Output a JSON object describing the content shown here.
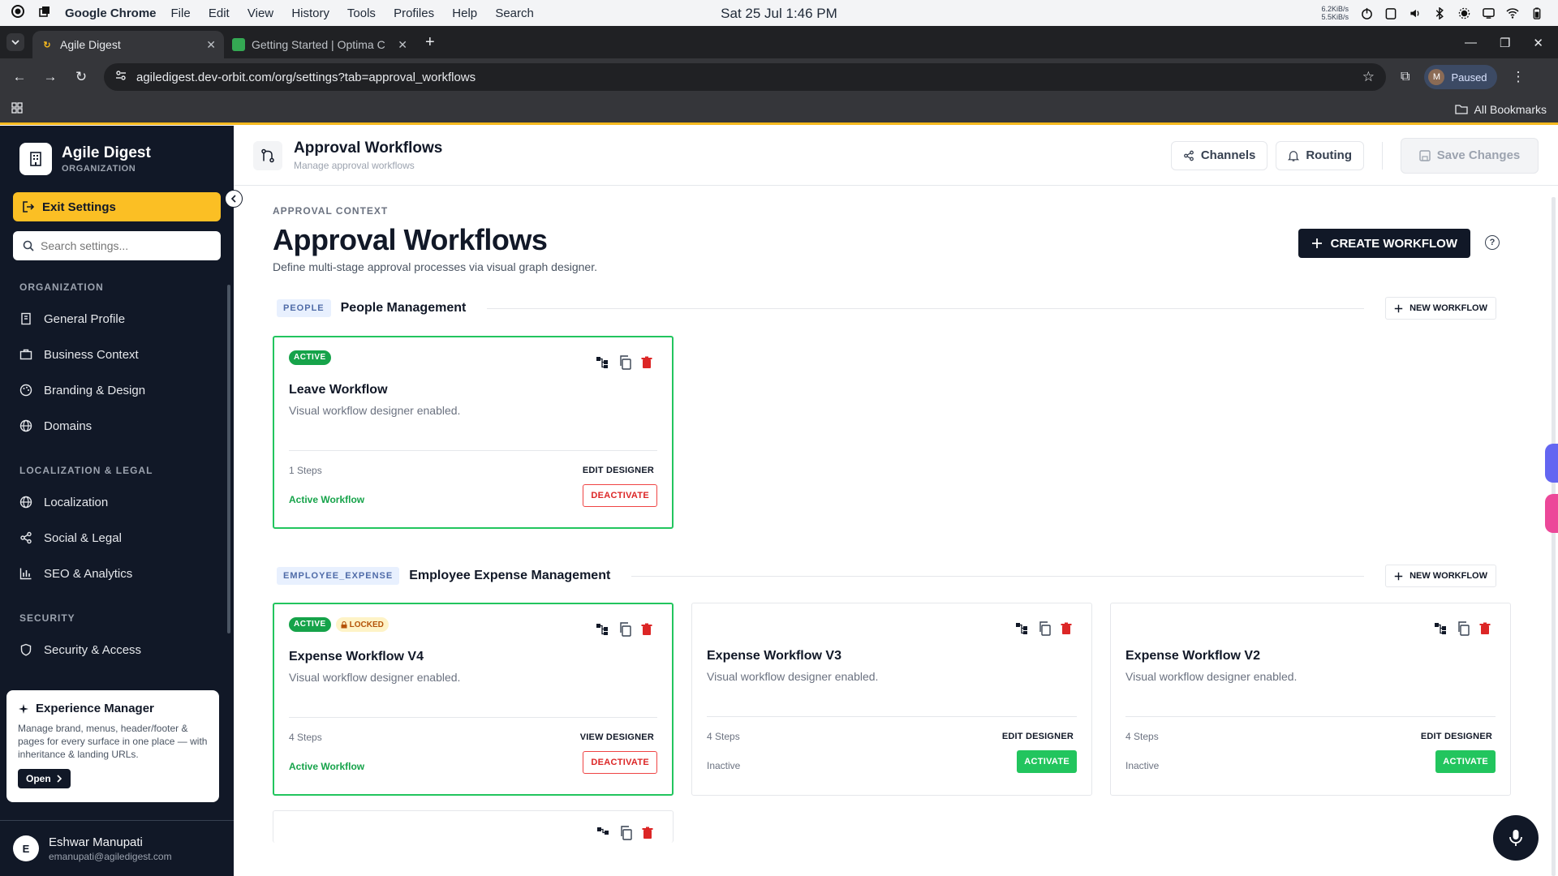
{
  "os": {
    "app_name": "Google Chrome",
    "menu": [
      "File",
      "Edit",
      "View",
      "History",
      "Tools",
      "Profiles",
      "Help",
      "Search"
    ],
    "clock": "Sat 25 Jul  1:46 PM",
    "net_up": "6.2KiB/s",
    "net_down": "5.5KiB/s"
  },
  "browser": {
    "tabs": [
      {
        "title": "Agile Digest",
        "active": true
      },
      {
        "title": "Getting Started | Optima C",
        "active": false
      }
    ],
    "url": "agiledigest.dev-orbit.com/org/settings?tab=approval_workflows",
    "profile_initial": "M",
    "profile_status": "Paused",
    "bookmarks_label": "All Bookmarks"
  },
  "sidebar": {
    "org_name": "Agile Digest",
    "org_type": "ORGANIZATION",
    "exit_label": "Exit Settings",
    "search_placeholder": "Search settings...",
    "sections": [
      {
        "title": "ORGANIZATION",
        "items": [
          {
            "label": "General Profile",
            "icon": "building-icon"
          },
          {
            "label": "Business Context",
            "icon": "briefcase-icon"
          },
          {
            "label": "Branding & Design",
            "icon": "palette-icon"
          },
          {
            "label": "Domains",
            "icon": "globe-icon"
          }
        ]
      },
      {
        "title": "LOCALIZATION & LEGAL",
        "items": [
          {
            "label": "Localization",
            "icon": "globe-icon"
          },
          {
            "label": "Social & Legal",
            "icon": "share-icon"
          },
          {
            "label": "SEO & Analytics",
            "icon": "bar-chart-icon"
          }
        ]
      },
      {
        "title": "SECURITY",
        "items": [
          {
            "label": "Security & Access",
            "icon": "shield-icon"
          }
        ]
      }
    ],
    "experience": {
      "title": "Experience Manager",
      "description": "Manage brand, menus, header/footer & pages for every surface in one place — with inheritance & landing URLs.",
      "open_label": "Open"
    },
    "user": {
      "initial": "E",
      "name": "Eshwar Manupati",
      "email": "emanupati@agiledigest.com"
    }
  },
  "header": {
    "title": "Approval Workflows",
    "subtitle": "Manage approval workflows",
    "channels_label": "Channels",
    "routing_label": "Routing",
    "save_label": "Save Changes"
  },
  "main": {
    "eyebrow": "APPROVAL CONTEXT",
    "title": "Approval Workflows",
    "subtitle": "Define multi-stage approval processes via visual graph designer.",
    "create_label": "CREATE WORKFLOW",
    "new_workflow_label": "NEW WORKFLOW",
    "groups": [
      {
        "tag": "PEOPLE",
        "name": "People Management",
        "cards": [
          {
            "title": "Leave Workflow",
            "desc": "Visual workflow designer enabled.",
            "steps": "1 Steps",
            "designer": "EDIT DESIGNER",
            "status": "Active Workflow",
            "action": "DEACTIVATE",
            "active": true,
            "locked": false
          }
        ]
      },
      {
        "tag": "EMPLOYEE_EXPENSE",
        "name": "Employee Expense Management",
        "cards": [
          {
            "title": "Expense Workflow V4",
            "desc": "Visual workflow designer enabled.",
            "steps": "4 Steps",
            "designer": "VIEW DESIGNER",
            "status": "Active Workflow",
            "action": "DEACTIVATE",
            "active": true,
            "locked": true
          },
          {
            "title": "Expense Workflow V3",
            "desc": "Visual workflow designer enabled.",
            "steps": "4 Steps",
            "designer": "EDIT DESIGNER",
            "status": "Inactive",
            "action": "ACTIVATE",
            "active": false,
            "locked": false
          },
          {
            "title": "Expense Workflow V2",
            "desc": "Visual workflow designer enabled.",
            "steps": "4 Steps",
            "designer": "EDIT DESIGNER",
            "status": "Inactive",
            "action": "ACTIVATE",
            "active": false,
            "locked": false
          }
        ]
      }
    ],
    "badge_active": "ACTIVE",
    "badge_locked": "LOCKED"
  }
}
